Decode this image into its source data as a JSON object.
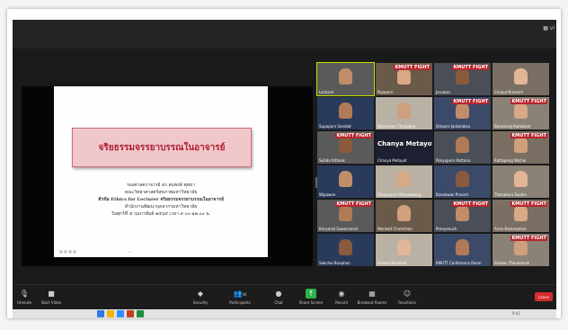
{
  "topbar": {
    "view_label": "▦ vi"
  },
  "slide": {
    "title": "จริยธรรมจรรยาบรรณในอาจารย์",
    "lines": [
      "รองศาสตราจารย์ ดร.สมพงษ์ พุทธา",
      "คณะวิทยาศาสตร์สุขภาพมหาวิทยาลัย",
      "หัวข้อ Ethics for Lecturer จริยธรรมจรรยาบรรณในอาจารย์",
      "สำนักงานพัฒนาบุคลากรมหาวิทยาลัย",
      "วันศุกร์ที่ ๕ กุมภาพันธ์ ๒๕๖๕ เวลา ๙.๐๐-๑๒.๐๐ น."
    ],
    "footer": "■ ■ ■ ■"
  },
  "participants": [
    {
      "name": "Lecturer",
      "badge": ""
    },
    {
      "name": "Piyaporn",
      "badge": "KMUTT FIGHT"
    },
    {
      "name": "Jaruwan",
      "badge": "KMUTT FIGHT"
    },
    {
      "name": "Chayut Kraisorn",
      "badge": ""
    },
    {
      "name": "Supaporn Sombat",
      "badge": ""
    },
    {
      "name": "Naruemon Thongdee",
      "badge": ""
    },
    {
      "name": "Siriporn Jantaraksa",
      "badge": "KMUTT FIGHT"
    },
    {
      "name": "Boonsong Kaewkam",
      "badge": "KMUTT FIGHT"
    },
    {
      "name": "Sutida Kittisak",
      "badge": "KMUTT FIGHT"
    },
    {
      "name": "Chanya Metayot",
      "badge": "",
      "big": "Chanya  Metayot..."
    },
    {
      "name": "Panyaporn Rattana",
      "badge": ""
    },
    {
      "name": "Rattapong Wichai",
      "badge": "KMUTT FIGHT"
    },
    {
      "name": "Wipawee",
      "badge": ""
    },
    {
      "name": "Chaiyaporn Maneewong",
      "badge": ""
    },
    {
      "name": "Kanokwan Prasert",
      "badge": ""
    },
    {
      "name": "Thanakorn Saelim",
      "badge": ""
    },
    {
      "name": "Kanyarat Suwannarat",
      "badge": "KMUTT FIGHT"
    },
    {
      "name": "Worawit Chomchan",
      "badge": ""
    },
    {
      "name": "Preeyanuch",
      "badge": "KMUTT FIGHT"
    },
    {
      "name": "Anan Kamonphan",
      "badge": "KMUTT FIGHT"
    },
    {
      "name": "Sakchai Buaphan",
      "badge": ""
    },
    {
      "name": "Arisara Khamsai",
      "badge": ""
    },
    {
      "name": "KMUTT Conference Room",
      "badge": ""
    },
    {
      "name": "Siriwan Thanomsak",
      "badge": "KMUTT FIGHT"
    }
  ],
  "toolbar": {
    "unmute": "Unmute",
    "start_video": "Start Video",
    "security": "Security",
    "participants": "Participants",
    "participants_count": "44",
    "chat": "Chat",
    "share_screen": "Share Screen",
    "record": "Record",
    "breakout_rooms": "Breakout Rooms",
    "reactions": "Reactions",
    "leave": "Leave"
  },
  "taskbar": {
    "time": "9:41"
  }
}
